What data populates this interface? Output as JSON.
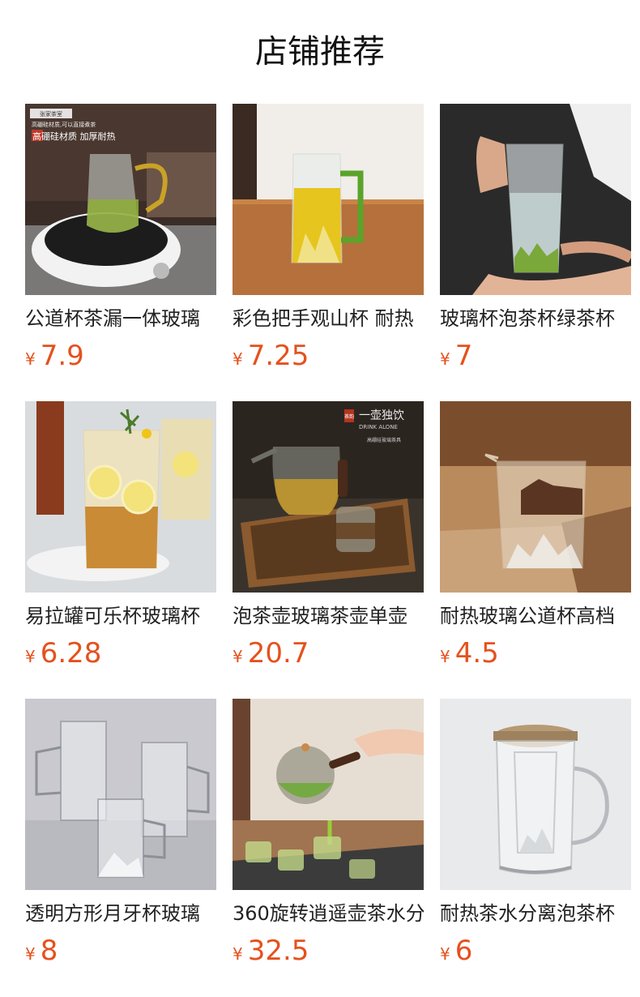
{
  "page": {
    "title": "店铺推荐"
  },
  "currency_symbol": "¥",
  "accent_color": "#e5511d",
  "products": [
    {
      "name": "公道杯茶漏一体玻璃",
      "price": "7.9",
      "image": {
        "icon": "glass-pitcher-on-stove-image",
        "overlay_badge": "张家茶室",
        "overlay_line": "高硼硅材质,可以直接煮茶",
        "overlay_headline": "高硼硅材质 加厚耐热"
      }
    },
    {
      "name": "彩色把手观山杯 耐热",
      "price": "7.25",
      "image": {
        "icon": "green-handle-mountain-cup-image"
      }
    },
    {
      "name": "玻璃杯泡茶杯绿茶杯",
      "price": "7",
      "image": {
        "icon": "hand-holding-tea-glass-image"
      }
    },
    {
      "name": "易拉罐可乐杯玻璃杯",
      "price": "6.28",
      "image": {
        "icon": "lemon-soda-can-glass-image"
      }
    },
    {
      "name": "泡茶壶玻璃茶壶单壶",
      "price": "20.7",
      "image": {
        "icon": "glass-teapot-set-image",
        "overlay_seal": "茶韵",
        "overlay_headline": "一壶独饮",
        "overlay_subtitle": "DRINK ALONE",
        "overlay_line": "高硼硅玻璃茶具"
      }
    },
    {
      "name": "耐热玻璃公道杯高档",
      "price": "4.5",
      "image": {
        "icon": "mountain-fair-cup-image"
      }
    },
    {
      "name": "透明方形月牙杯玻璃",
      "price": "8",
      "image": {
        "icon": "square-glass-pitchers-image"
      }
    },
    {
      "name": "360旋转逍遥壶茶水分",
      "price": "32.5",
      "image": {
        "icon": "pouring-teapot-image"
      }
    },
    {
      "name": "耐热茶水分离泡茶杯",
      "price": "6",
      "image": {
        "icon": "lidded-tea-mug-image"
      }
    }
  ]
}
